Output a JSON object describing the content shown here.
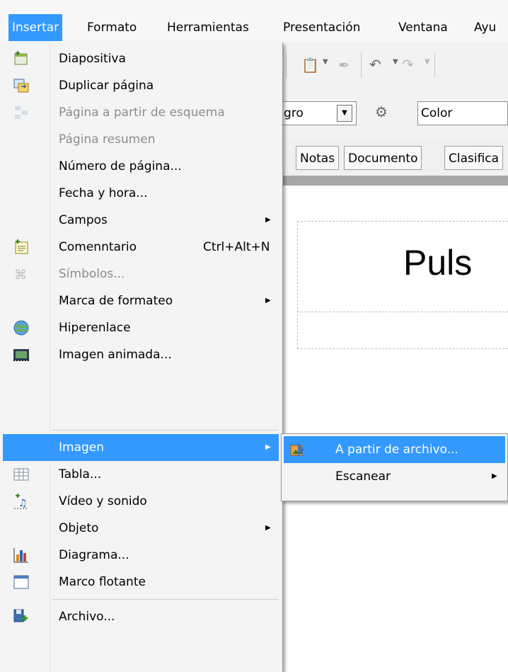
{
  "menubar": {
    "items": [
      "Insertar",
      "Formato",
      "Herramientas",
      "Presentación",
      "Ventana",
      "Ayu"
    ],
    "active": "Insertar"
  },
  "toolbar": {
    "font_partial": "gro",
    "color_label": "Color"
  },
  "view_tabs": [
    "Notas",
    "Documento",
    "Clasifica"
  ],
  "slide": {
    "title_partial": "Puls"
  },
  "insert_menu": {
    "items": [
      {
        "label": "Diapositiva",
        "icon": "new-slide-icon",
        "enabled": true
      },
      {
        "label": "Duplicar página",
        "icon": "duplicate-page-icon",
        "enabled": true
      },
      {
        "label": "Página a partir de esquema",
        "icon": "outline-page-icon",
        "enabled": false
      },
      {
        "label": "Página resumen",
        "enabled": false
      },
      {
        "label": "Número de página...",
        "enabled": true
      },
      {
        "label": "Fecha y hora...",
        "enabled": true
      },
      {
        "label": "Campos",
        "enabled": true,
        "submenu": true
      },
      {
        "label": "Comenntario",
        "shortcut": "Ctrl+Alt+N",
        "icon": "comment-icon",
        "enabled": true
      },
      {
        "label": "Símbolos...",
        "icon": "symbols-icon",
        "enabled": false
      },
      {
        "label": "Marca de formateo",
        "enabled": true,
        "submenu": true
      },
      {
        "label": "Hiperenlace",
        "icon": "hyperlink-icon",
        "enabled": true
      },
      {
        "label": "Imagen animada...",
        "icon": "animated-image-icon",
        "enabled": true
      },
      {
        "label": "Imagen",
        "enabled": true,
        "submenu": true,
        "selected": true
      },
      {
        "label": "Tabla...",
        "icon": "table-icon",
        "enabled": true
      },
      {
        "label": "Vídeo y sonido",
        "icon": "video-sound-icon",
        "enabled": true
      },
      {
        "label": "Objeto",
        "enabled": true,
        "submenu": true
      },
      {
        "label": "Diagrama...",
        "icon": "chart-icon",
        "enabled": true
      },
      {
        "label": "Marco flotante",
        "icon": "floating-frame-icon",
        "enabled": true
      },
      {
        "label": "Archivo...",
        "icon": "insert-file-icon",
        "enabled": true
      }
    ]
  },
  "image_submenu": {
    "items": [
      {
        "label": "A partir de archivo...",
        "icon": "image-from-file-icon",
        "selected": true
      },
      {
        "label": "Escanear",
        "submenu": true
      }
    ]
  },
  "colors": {
    "highlight": "#3399ff",
    "menu_bg": "#f4f4f4",
    "disabled_text": "#8d8d8d"
  }
}
